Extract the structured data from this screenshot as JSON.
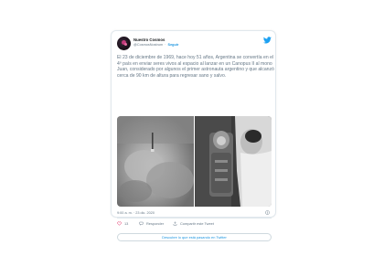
{
  "tweet": {
    "author_name": "Nuestro Cosmos",
    "author_handle": "@CosmosNostrum",
    "separator": "·",
    "follow_label": "Seguir",
    "text": "El 23 de diciembre de 1969, hace hoy 51 años, Argentina se convertía en el 4º país en enviar seres vivos al espacio al lanzar en un Canopus II al mono Juan, considerado por algunos el primer astronauta argentino y que alcanzó cerca de 90 km de altura para regresar sano y salvo.",
    "timestamp": "9:00 a. m. · 23 dic. 2020",
    "like_count": "13",
    "reply_label": "Responder",
    "share_label": "Compartir este Tweet",
    "cta_label": "Descubre lo que está pasando en Twitter"
  },
  "colors": {
    "link": "#1b95e0",
    "muted": "#657786",
    "name": "#14171a",
    "like": "#e0245e",
    "twitter_blue": "#1da1f2"
  },
  "icons": {
    "logo": "twitter-bird-icon",
    "info": "info-icon",
    "like": "heart-icon",
    "reply": "speech-bubble-icon",
    "share": "upload-icon"
  }
}
